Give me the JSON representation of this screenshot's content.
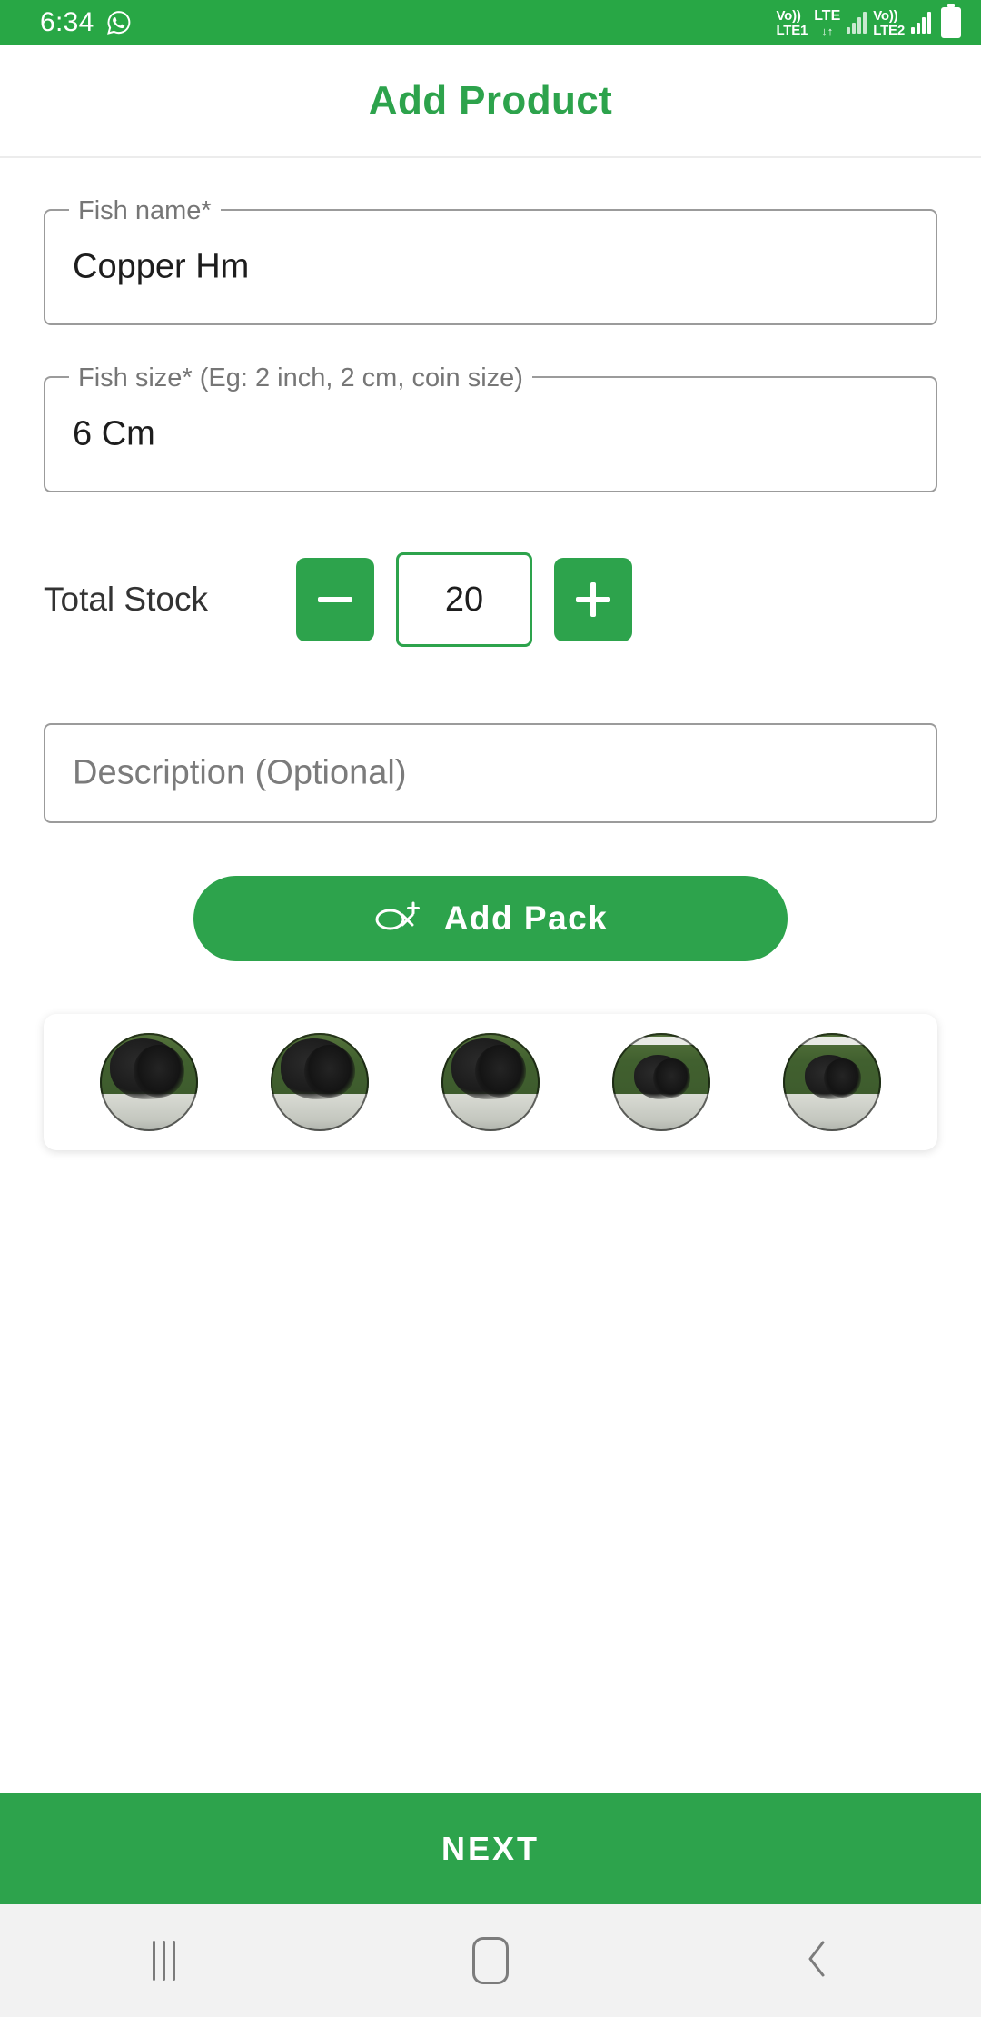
{
  "status_bar": {
    "time": "6:34",
    "whatsapp_icon": "whatsapp-icon",
    "sim1_volte": "Vo))",
    "sim1_label": "LTE1",
    "network_type": "LTE",
    "data_arrows": "↓↑",
    "sim2_volte": "Vo))",
    "sim2_label": "LTE2",
    "battery_icon": "battery-icon",
    "background_color": "#28a745"
  },
  "app_bar": {
    "title": "Add Product",
    "title_color": "#2da34c"
  },
  "form": {
    "fish_name": {
      "label": "Fish name*",
      "value": "Copper Hm"
    },
    "fish_size": {
      "label": "Fish size* (Eg: 2 inch, 2 cm, coin size)",
      "value": "6 Cm"
    },
    "stock": {
      "label": "Total Stock",
      "value": "20",
      "decrement_icon": "minus-icon",
      "increment_icon": "plus-icon"
    },
    "description": {
      "placeholder": "Description (Optional)",
      "value": ""
    },
    "add_pack": {
      "label": "Add Pack",
      "icon": "fish-plus-icon",
      "color": "#2da34c"
    }
  },
  "thumbnails": {
    "count": 5,
    "items": [
      {
        "name": "product-image-1",
        "variant": "front"
      },
      {
        "name": "product-image-2",
        "variant": "front"
      },
      {
        "name": "product-image-3",
        "variant": "front"
      },
      {
        "name": "product-image-4",
        "variant": "side"
      },
      {
        "name": "product-image-5",
        "variant": "side"
      }
    ]
  },
  "bottom": {
    "next_label": "NEXT",
    "next_color": "#2da34c"
  },
  "nav_bar": {
    "recents_icon": "recents-icon",
    "home_icon": "home-icon",
    "back_icon": "back-chevron-icon"
  }
}
